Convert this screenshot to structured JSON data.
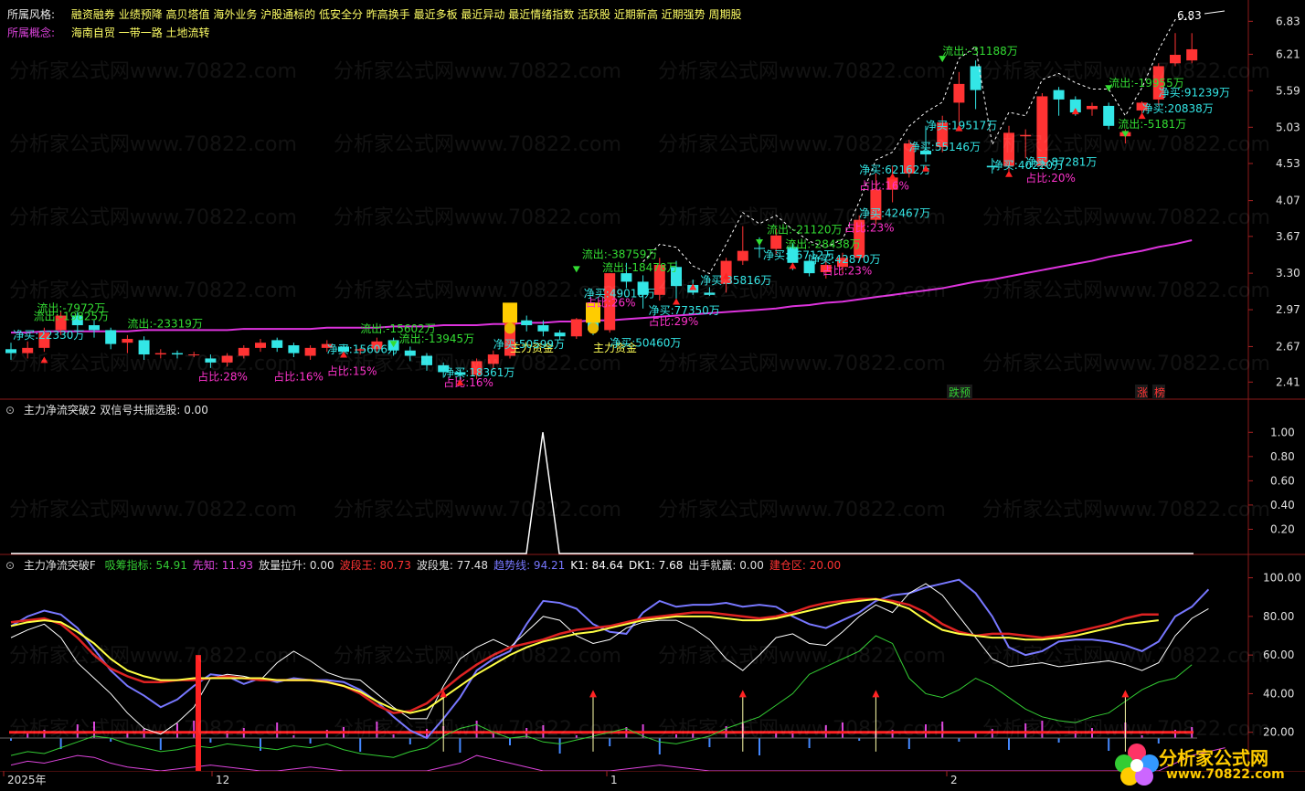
{
  "header": {
    "style_label": "所属风格:",
    "style_tags": "融资融券 业绩预降 高贝塔值 海外业务 沪股通标的 低安全分 昨高换手 最近多板 最近异动 最近情绪指数 活跃股 近期新高 近期强势 周期股",
    "concept_label": "所属概念:",
    "concept_tags": "海南自贸 一带一路 土地流转",
    "high_price": "6.83"
  },
  "watermark": "分析家公式网www.70822.com",
  "logo": {
    "name": "分析家公式网",
    "url": "www.70822.com"
  },
  "main_chart": {
    "price_axis": [
      "6.83",
      "6.21",
      "5.59",
      "5.03",
      "4.53",
      "4.07",
      "3.67",
      "3.30",
      "2.97",
      "2.67",
      "2.41"
    ],
    "signals": [
      {
        "text": "流出:-7972万",
        "color": "green"
      },
      {
        "text": "流出:-19825万",
        "color": "green"
      },
      {
        "text": "净买:22330万",
        "color": "cyan"
      },
      {
        "text": "流出:-23319万",
        "color": "green"
      },
      {
        "text": "占比:28%",
        "color": "magenta"
      },
      {
        "text": "流出:-15602万",
        "color": "green"
      },
      {
        "text": "净买:15606万",
        "color": "cyan"
      },
      {
        "text": "占比:16%",
        "color": "magenta"
      },
      {
        "text": "占比:15%",
        "color": "magenta"
      },
      {
        "text": "流出:-13945万",
        "color": "green"
      },
      {
        "text": "净买:18361万",
        "color": "cyan"
      },
      {
        "text": "占比:16%",
        "color": "magenta"
      },
      {
        "text": "主力资金",
        "color": "yellow"
      },
      {
        "text": "主力资金",
        "color": "yellow"
      },
      {
        "text": "净买:50599万",
        "color": "cyan"
      },
      {
        "text": "净买:50460万",
        "color": "cyan"
      },
      {
        "text": "流出:-38759万",
        "color": "green"
      },
      {
        "text": "流出:-18478万",
        "color": "green"
      },
      {
        "text": "净买:49010万",
        "color": "cyan"
      },
      {
        "text": "占比:26%",
        "color": "magenta"
      },
      {
        "text": "净买:77350万",
        "color": "cyan"
      },
      {
        "text": "占比:29%",
        "color": "magenta"
      },
      {
        "text": "净买:35816万",
        "color": "cyan"
      },
      {
        "text": "流出:-21120万",
        "color": "green"
      },
      {
        "text": "净买:56712万",
        "color": "cyan"
      },
      {
        "text": "流出:-28438万",
        "color": "green"
      },
      {
        "text": "净买:42870万",
        "color": "cyan"
      },
      {
        "text": "占比:23%",
        "color": "magenta"
      },
      {
        "text": "净买:42467万",
        "color": "cyan"
      },
      {
        "text": "占比:23%",
        "color": "magenta"
      },
      {
        "text": "净买:62162万",
        "color": "cyan"
      },
      {
        "text": "占比:16%",
        "color": "magenta"
      },
      {
        "text": "净买:55146万",
        "color": "cyan"
      },
      {
        "text": "净买:19517万",
        "color": "cyan"
      },
      {
        "text": "流出:-31188万",
        "color": "green"
      },
      {
        "text": "净买:40220万",
        "color": "cyan"
      },
      {
        "text": "净买:87281万",
        "color": "cyan"
      },
      {
        "text": "占比:20%",
        "color": "magenta"
      },
      {
        "text": "流出:-19955万",
        "color": "green"
      },
      {
        "text": "净买:91239万",
        "color": "cyan"
      },
      {
        "text": "净买:20838万",
        "color": "cyan"
      },
      {
        "text": "流出:-5181万",
        "color": "green"
      }
    ],
    "bottom_tags": [
      {
        "text": "跌预",
        "color": "#33cc33"
      },
      {
        "text": "涨",
        "color": "#ff3333"
      },
      {
        "text": "榜",
        "color": "#ff3333"
      }
    ]
  },
  "panel2": {
    "title": "主力净流突破2 双信号共振选股: 0.00",
    "axis": [
      "1.00",
      "0.80",
      "0.60",
      "0.40",
      "0.20"
    ]
  },
  "panel3": {
    "title_name": "主力净流突破F",
    "indicators": [
      {
        "label": "吸筹指标: 54.91",
        "color": "#33cc33"
      },
      {
        "label": "先知: 11.93",
        "color": "#dd44dd"
      },
      {
        "label": "放量拉升: 0.00",
        "color": "#e0e0e0"
      },
      {
        "label": "波段王: 80.73",
        "color": "#ff3333"
      },
      {
        "label": "波段鬼: 77.48",
        "color": "#e0e0e0"
      },
      {
        "label": "趋势线: 94.21",
        "color": "#7777ff"
      },
      {
        "label": "K1: 84.64",
        "color": "#ffffff"
      },
      {
        "label": "DK1: 7.68",
        "color": "#ffffff"
      },
      {
        "label": "出手就赢: 0.00",
        "color": "#e0e0e0"
      },
      {
        "label": "建仓区: 20.00",
        "color": "#ff3333"
      }
    ],
    "axis": [
      "100.00",
      "80.00",
      "60.00",
      "40.00",
      "20.00"
    ]
  },
  "x_axis": [
    "2025年",
    "12",
    "1",
    "2"
  ],
  "chart_data": [
    {
      "type": "candlestick",
      "title": "",
      "y_scale": "log",
      "ylim": [
        2.3,
        7.0
      ],
      "candles": [
        [
          2.65,
          2.62,
          2.7,
          2.57
        ],
        [
          2.62,
          2.66,
          2.71,
          2.58
        ],
        [
          2.66,
          2.78,
          2.82,
          2.63
        ],
        [
          2.8,
          2.92,
          2.96,
          2.76
        ],
        [
          2.92,
          2.84,
          2.95,
          2.8
        ],
        [
          2.84,
          2.8,
          2.88,
          2.74
        ],
        [
          2.8,
          2.69,
          2.82,
          2.65
        ],
        [
          2.7,
          2.73,
          2.76,
          2.62
        ],
        [
          2.72,
          2.61,
          2.75,
          2.57
        ],
        [
          2.61,
          2.62,
          2.65,
          2.58
        ],
        [
          2.62,
          2.61,
          2.64,
          2.58
        ],
        [
          2.61,
          2.61,
          2.63,
          2.59
        ],
        [
          2.58,
          2.55,
          2.61,
          2.51
        ],
        [
          2.55,
          2.6,
          2.62,
          2.52
        ],
        [
          2.6,
          2.66,
          2.68,
          2.58
        ],
        [
          2.66,
          2.7,
          2.73,
          2.63
        ],
        [
          2.72,
          2.66,
          2.74,
          2.63
        ],
        [
          2.68,
          2.62,
          2.7,
          2.59
        ],
        [
          2.6,
          2.66,
          2.68,
          2.57
        ],
        [
          2.66,
          2.69,
          2.72,
          2.63
        ],
        [
          2.67,
          2.63,
          2.69,
          2.6
        ],
        [
          2.64,
          2.65,
          2.66,
          2.61
        ],
        [
          2.65,
          2.71,
          2.74,
          2.62
        ],
        [
          2.72,
          2.64,
          2.74,
          2.6
        ],
        [
          2.64,
          2.6,
          2.67,
          2.56
        ],
        [
          2.6,
          2.53,
          2.62,
          2.49
        ],
        [
          2.53,
          2.48,
          2.55,
          2.44
        ],
        [
          2.48,
          2.46,
          2.5,
          2.42
        ],
        [
          2.46,
          2.56,
          2.58,
          2.43
        ],
        [
          2.54,
          2.61,
          2.64,
          2.5
        ],
        [
          2.6,
          2.89,
          2.9,
          2.58
        ],
        [
          2.88,
          2.84,
          2.92,
          2.79
        ],
        [
          2.84,
          2.79,
          2.88,
          2.75
        ],
        [
          2.78,
          2.75,
          2.8,
          2.72
        ],
        [
          2.75,
          2.89,
          2.9,
          2.73
        ],
        [
          2.9,
          2.8,
          2.96,
          2.76
        ],
        [
          2.8,
          3.3,
          3.3,
          2.78
        ],
        [
          3.3,
          3.22,
          3.4,
          3.16
        ],
        [
          3.22,
          3.1,
          3.28,
          2.98
        ],
        [
          3.1,
          3.38,
          3.45,
          3.05
        ],
        [
          3.36,
          3.18,
          3.42,
          3.05
        ],
        [
          3.19,
          3.12,
          3.24,
          3.1
        ],
        [
          3.12,
          3.1,
          3.17,
          3.09
        ],
        [
          3.2,
          3.42,
          3.45,
          3.12
        ],
        [
          3.42,
          3.52,
          3.78,
          3.38
        ],
        [
          3.55,
          3.54,
          3.66,
          3.45
        ],
        [
          3.54,
          3.68,
          3.75,
          3.48
        ],
        [
          3.56,
          3.4,
          3.6,
          3.33
        ],
        [
          3.42,
          3.3,
          3.48,
          3.27
        ],
        [
          3.31,
          3.38,
          3.42,
          3.25
        ],
        [
          3.36,
          3.45,
          3.5,
          3.3
        ],
        [
          3.45,
          3.85,
          3.9,
          3.42
        ],
        [
          3.85,
          4.2,
          4.4,
          3.8
        ],
        [
          4.2,
          4.35,
          4.5,
          4.05
        ],
        [
          4.4,
          4.8,
          4.85,
          4.35
        ],
        [
          4.7,
          4.65,
          5.05,
          4.55
        ],
        [
          4.75,
          5.1,
          5.2,
          4.68
        ],
        [
          5.4,
          5.7,
          5.9,
          5.0
        ],
        [
          6.0,
          5.6,
          6.1,
          5.3
        ],
        [
          4.5,
          4.48,
          4.6,
          4.4
        ],
        [
          4.5,
          4.95,
          5.05,
          4.4
        ],
        [
          4.9,
          4.92,
          5.0,
          4.6
        ],
        [
          4.5,
          5.5,
          5.55,
          4.45
        ],
        [
          5.6,
          5.45,
          5.65,
          5.2
        ],
        [
          5.45,
          5.25,
          5.5,
          5.2
        ],
        [
          5.3,
          5.35,
          5.4,
          5.2
        ],
        [
          5.35,
          5.05,
          5.4,
          5.0
        ],
        [
          4.9,
          4.96,
          5.0,
          4.8
        ],
        [
          5.28,
          5.4,
          5.42,
          5.24
        ],
        [
          5.45,
          6.0,
          6.05,
          5.35
        ],
        [
          6.05,
          6.2,
          6.6,
          6.0
        ],
        [
          6.1,
          6.3,
          6.6,
          6.05
        ]
      ],
      "ma": [
        2.78,
        2.78,
        2.79,
        2.79,
        2.79,
        2.79,
        2.79,
        2.79,
        2.8,
        2.8,
        2.8,
        2.8,
        2.8,
        2.8,
        2.81,
        2.81,
        2.81,
        2.81,
        2.81,
        2.82,
        2.82,
        2.82,
        2.82,
        2.83,
        2.83,
        2.83,
        2.84,
        2.84,
        2.84,
        2.85,
        2.85,
        2.86,
        2.86,
        2.87,
        2.87,
        2.88,
        2.88,
        2.89,
        2.9,
        2.91,
        2.92,
        2.93,
        2.94,
        2.95,
        2.96,
        2.97,
        2.98,
        3.0,
        3.01,
        3.03,
        3.04,
        3.06,
        3.08,
        3.1,
        3.12,
        3.14,
        3.16,
        3.19,
        3.22,
        3.24,
        3.27,
        3.3,
        3.33,
        3.36,
        3.39,
        3.42,
        3.46,
        3.49,
        3.52,
        3.56,
        3.59,
        3.63
      ]
    },
    {
      "type": "line",
      "title": "主力净流突破2 双信号共振选股",
      "ylim": [
        0,
        1.1
      ],
      "series": [
        {
          "name": "双信号共振选股",
          "values": "0 everywhere except a spike to 1.00 in mid-December"
        }
      ]
    },
    {
      "type": "line",
      "title": "主力净流突破F",
      "ylim": [
        0,
        105
      ],
      "hline": 20,
      "series": [
        {
          "name": "趋势线",
          "values": [
            75,
            80,
            83,
            81,
            74,
            63,
            52,
            44,
            39,
            33,
            37,
            44,
            50,
            49,
            45,
            48,
            46,
            48,
            47,
            47,
            46,
            42,
            36,
            28,
            21,
            17,
            27,
            38,
            52,
            58,
            62,
            76,
            88,
            87,
            84,
            76,
            72,
            71,
            82,
            88,
            85,
            86,
            86,
            87,
            85,
            86,
            85,
            80,
            76,
            74,
            78,
            82,
            88,
            91,
            92,
            95,
            97,
            99,
            92,
            80,
            64,
            60,
            62,
            67,
            68,
            68,
            67,
            65,
            62,
            67,
            80,
            85,
            94
          ]
        },
        {
          "name": "K1",
          "values": [
            69,
            73,
            76,
            69,
            56,
            48,
            40,
            30,
            22,
            19,
            25,
            33,
            48,
            50,
            49,
            47,
            56,
            62,
            57,
            51,
            48,
            47,
            40,
            33,
            27,
            27,
            44,
            58,
            64,
            68,
            64,
            72,
            80,
            78,
            70,
            66,
            68,
            74,
            77,
            78,
            78,
            74,
            68,
            58,
            52,
            60,
            69,
            71,
            66,
            65,
            72,
            80,
            86,
            82,
            92,
            97,
            91,
            80,
            69,
            58,
            54,
            55,
            56,
            54,
            55,
            56,
            57,
            55,
            52,
            56,
            70,
            79,
            84
          ]
        },
        {
          "name": "波段王",
          "values": [
            77,
            78,
            79,
            76,
            69,
            60,
            53,
            49,
            46,
            46,
            47,
            47,
            48,
            49,
            48,
            47,
            47,
            47,
            47,
            46,
            44,
            40,
            34,
            30,
            31,
            35,
            42,
            49,
            55,
            60,
            64,
            66,
            68,
            71,
            73,
            74,
            75,
            77,
            79,
            80,
            81,
            82,
            82,
            81,
            80,
            79,
            80,
            82,
            85,
            87,
            88,
            89,
            89,
            88,
            86,
            82,
            76,
            72,
            70,
            71,
            71,
            70,
            69,
            70,
            72,
            74,
            76,
            79,
            81,
            81
          ]
        },
        {
          "name": "波段鬼",
          "values": [
            75,
            77,
            78,
            77,
            72,
            66,
            58,
            52,
            49,
            47,
            47,
            48,
            48,
            48,
            48,
            48,
            47,
            47,
            47,
            46,
            44,
            41,
            36,
            32,
            30,
            32,
            38,
            44,
            50,
            55,
            60,
            64,
            67,
            69,
            71,
            72,
            74,
            76,
            78,
            79,
            80,
            80,
            80,
            79,
            78,
            78,
            79,
            81,
            83,
            85,
            87,
            88,
            89,
            87,
            84,
            78,
            73,
            71,
            70,
            69,
            69,
            68,
            68,
            69,
            70,
            72,
            74,
            76,
            77,
            78
          ]
        },
        {
          "name": "吸筹指标",
          "values": [
            8,
            10,
            9,
            12,
            15,
            18,
            17,
            14,
            12,
            10,
            11,
            13,
            12,
            14,
            13,
            12,
            11,
            13,
            12,
            14,
            11,
            9,
            8,
            7,
            10,
            12,
            18,
            22,
            24,
            20,
            17,
            18,
            15,
            14,
            16,
            18,
            20,
            22,
            18,
            15,
            14,
            16,
            18,
            22,
            25,
            28,
            34,
            40,
            50,
            54,
            58,
            62,
            70,
            66,
            48,
            40,
            38,
            42,
            48,
            44,
            38,
            32,
            28,
            26,
            25,
            28,
            30,
            36,
            42,
            46,
            48,
            55
          ]
        },
        {
          "name": "先知",
          "values": [
            3,
            5,
            4,
            6,
            8,
            7,
            4,
            2,
            1,
            0,
            1,
            2,
            3,
            2,
            1,
            0,
            0,
            1,
            2,
            1,
            0,
            0,
            0,
            0,
            0,
            0,
            2,
            4,
            8,
            6,
            4,
            2,
            0,
            0,
            0,
            0,
            0,
            1,
            2,
            3,
            2,
            1,
            0,
            0,
            0,
            0,
            0,
            0,
            0,
            0,
            0,
            0,
            0,
            0,
            0,
            0,
            0,
            0,
            0,
            0,
            0,
            0,
            0,
            0,
            0,
            0,
            0,
            0,
            0,
            0,
            4,
            8,
            10,
            12
          ]
        }
      ]
    }
  ]
}
